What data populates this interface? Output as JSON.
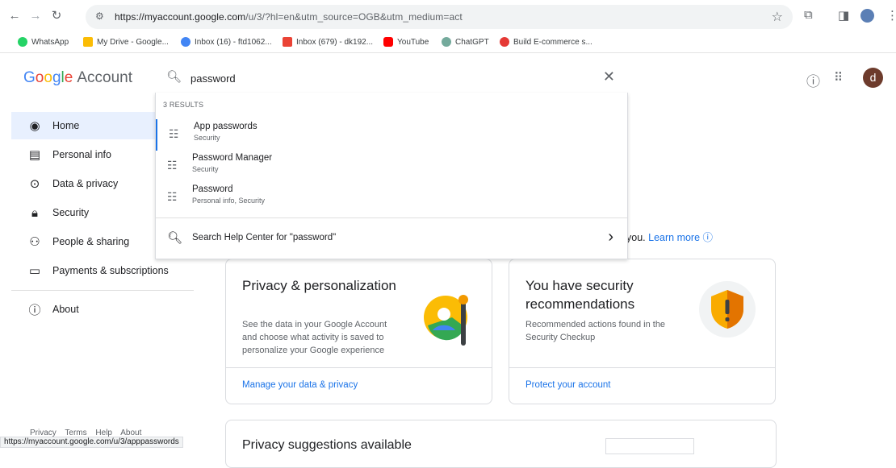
{
  "browser": {
    "url_host": "https://myaccount.google.com",
    "url_path": "/u/3/?hl=en&utm_source=OGB&utm_medium=act",
    "bookmarks": [
      {
        "label": "WhatsApp",
        "color": "#25d366"
      },
      {
        "label": "My Drive - Google...",
        "color": "#fbbc05"
      },
      {
        "label": "Inbox (16) - ftd1062...",
        "color": "#4285f4"
      },
      {
        "label": "Inbox (679) - dk192...",
        "color": "#ea4335"
      },
      {
        "label": "YouTube",
        "color": "#ff0000"
      },
      {
        "label": "ChatGPT",
        "color": "#74aa9c"
      },
      {
        "label": "Build E-commerce s...",
        "color": "#e53935"
      }
    ]
  },
  "header": {
    "logo_letters": [
      "G",
      "o",
      "o",
      "g",
      "l",
      "e"
    ],
    "account_label": "Account",
    "avatar_letter": "d"
  },
  "search": {
    "value": "password",
    "results_count": "3 RESULTS",
    "results": [
      {
        "title": "App passwords",
        "subtitle": "Security"
      },
      {
        "title": "Password Manager",
        "subtitle": "Security"
      },
      {
        "title": "Password",
        "subtitle": "Personal info, Security"
      }
    ],
    "help_label": "Search Help Center for \"password\""
  },
  "sidebar": {
    "items": [
      {
        "label": "Home",
        "icon": "home-icon"
      },
      {
        "label": "Personal info",
        "icon": "id-card-icon"
      },
      {
        "label": "Data & privacy",
        "icon": "toggle-icon"
      },
      {
        "label": "Security",
        "icon": "lock-icon"
      },
      {
        "label": "People & sharing",
        "icon": "people-icon"
      },
      {
        "label": "Payments & subscriptions",
        "icon": "card-icon"
      },
      {
        "label": "About",
        "icon": "info-icon"
      }
    ]
  },
  "main": {
    "learn_prefix": "you.",
    "learn_link": "Learn more",
    "privacy_card": {
      "title": "Privacy & personalization",
      "desc": "See the data in your Google Account and choose what activity is saved to personalize your Google experience",
      "link": "Manage your data & privacy"
    },
    "security_card": {
      "title": "You have security recommendations",
      "desc": "Recommended actions found in the Security Checkup",
      "link": "Protect your account"
    },
    "suggestions_title": "Privacy suggestions available"
  },
  "footer": {
    "links": [
      "Privacy",
      "Terms",
      "Help",
      "About"
    ],
    "status_url": "https://myaccount.google.com/u/3/apppasswords"
  }
}
